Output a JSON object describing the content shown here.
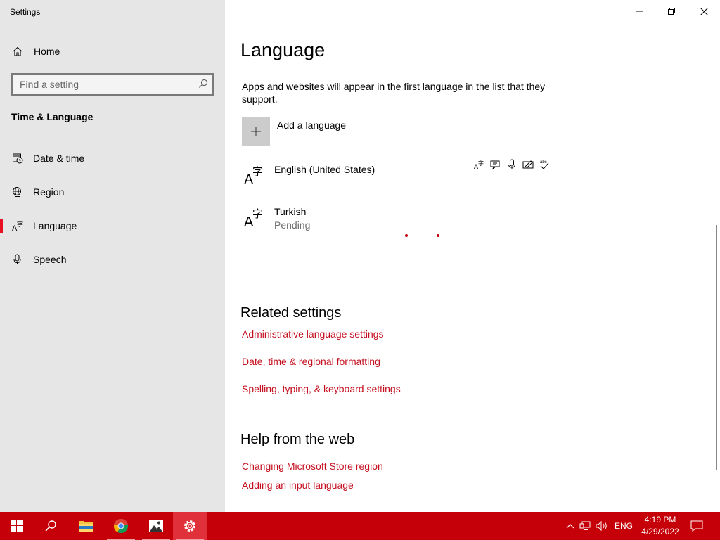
{
  "window": {
    "title": "Settings"
  },
  "sidebar": {
    "home_label": "Home",
    "search_placeholder": "Find a setting",
    "section_title": "Time & Language",
    "items": [
      {
        "label": "Date & time",
        "icon": "calendar-clock-icon"
      },
      {
        "label": "Region",
        "icon": "globe-icon"
      },
      {
        "label": "Language",
        "icon": "language-icon",
        "active": true
      },
      {
        "label": "Speech",
        "icon": "microphone-icon"
      }
    ]
  },
  "main": {
    "title": "Language",
    "description": "Apps and websites will appear in the first language in the list that they support.",
    "add_language_label": "Add a language",
    "languages": [
      {
        "name": "English (United States)",
        "status": ""
      },
      {
        "name": "Turkish",
        "status": "Pending"
      }
    ],
    "feature_icons": [
      "display-language-icon",
      "text-to-speech-icon",
      "speech-recognition-icon",
      "handwriting-icon",
      "spellcheck-icon"
    ],
    "related_settings": {
      "heading": "Related settings",
      "links": [
        "Administrative language settings",
        "Date, time & regional formatting",
        "Spelling, typing, & keyboard settings"
      ]
    },
    "help": {
      "heading": "Help from the web",
      "links": [
        "Changing Microsoft Store region",
        "Adding an input language"
      ]
    }
  },
  "taskbar": {
    "apps": [
      "start-icon",
      "search-icon",
      "file-explorer-icon",
      "chrome-icon",
      "photos-icon",
      "settings-icon"
    ],
    "tray": {
      "language": "ENG"
    },
    "clock": {
      "time": "4:19 PM",
      "date": "4/29/2022"
    }
  },
  "colors": {
    "accent": "#c50f1f",
    "taskbar": "#c50008",
    "sidebar": "#e6e6e6"
  }
}
